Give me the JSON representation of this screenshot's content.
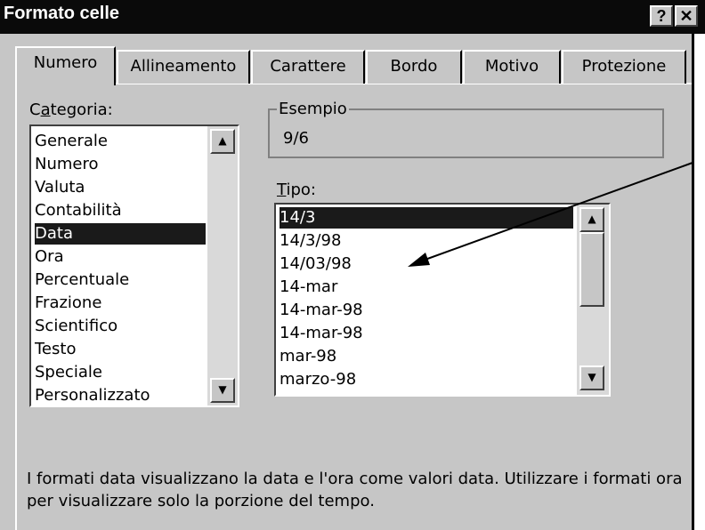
{
  "window": {
    "title": "Formato celle",
    "help_button": "?",
    "close_button": "✕"
  },
  "tabs": [
    {
      "label": "Numero",
      "active": true
    },
    {
      "label": "Allineamento",
      "active": false
    },
    {
      "label": "Carattere",
      "active": false
    },
    {
      "label": "Bordo",
      "active": false
    },
    {
      "label": "Motivo",
      "active": false
    },
    {
      "label": "Protezione",
      "active": false
    }
  ],
  "category": {
    "label_pre": "C",
    "label_accel": "a",
    "label_post": "tegoria:",
    "items": [
      "Generale",
      "Numero",
      "Valuta",
      "Contabilità",
      "Data",
      "Ora",
      "Percentuale",
      "Frazione",
      "Scientifico",
      "Testo",
      "Speciale",
      "Personalizzato"
    ],
    "selected": "Data"
  },
  "example": {
    "label": "Esempio",
    "value": "9/6"
  },
  "type": {
    "label_accel": "T",
    "label_post": "ipo:",
    "items": [
      "14/3",
      "14/3/98",
      "14/03/98",
      "14-mar",
      "14-mar-98",
      "14-mar-98",
      "mar-98",
      "marzo-98"
    ],
    "selected": "14/3"
  },
  "description": "I formati data visualizzano la data e l'ora come valori data. Utilizzare i formati ora per visualizzare solo la porzione del tempo.",
  "colors": {
    "selection": "#1a1a1a",
    "dialog": "#c6c6c6",
    "titlebar": "#0a0a0a"
  }
}
